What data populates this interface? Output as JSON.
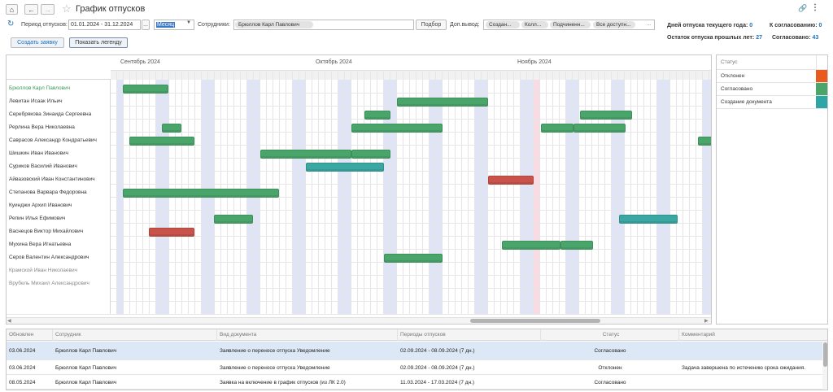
{
  "window": {
    "title": "График отпусков"
  },
  "filters": {
    "period_label": "Период отпусков:",
    "period_value": "01.01.2024 - 31.12.2024",
    "period_btn": "...",
    "scale_value": "Месяц",
    "employees_label": "Сотрудники:",
    "employee_chip": "Брюллов Карл Павлович",
    "select_btn": "Подбор",
    "extra_label": "Доп.вывод:",
    "extra_chips": [
      "Создан...",
      "Колл...",
      "Подчиненн...",
      "Все доступн..."
    ]
  },
  "stats": {
    "days_current_label": "Дней отпуска текущего года:",
    "days_current_value": "0",
    "to_approve_label": "К согласованию:",
    "to_approve_value": "0",
    "remaining_label": "Остаток отпуска прошлых лет:",
    "remaining_value": "27",
    "approved_label": "Согласовано:",
    "approved_value": "43"
  },
  "actions": {
    "create": "Создать заявку",
    "legend": "Показать легенду"
  },
  "timeline": {
    "months": [
      "Сентябрь 2024",
      "Октябрь 2024",
      "Ноябрь 2024"
    ],
    "employees": [
      "Брюллов Карл Павлович",
      "Левитан Исаак Ильич",
      "Серебрякова Зинаида Сергеевна",
      "Рерлина Вера Николаевна",
      "Саврасов Александр Кондратьевич",
      "Шишкин Иван Иванович",
      "Суриков Василий Иванович",
      "Айвазовский Иван Константинович",
      "Степанова Варвара Федоровна",
      "Куинджи Архип Иванович",
      "Репин Илья Ефимович",
      "Васнецов Виктор Михайлович",
      "Мухина Вера Игнатьевна",
      "Серов Валентин Александрович",
      "Крамской Иван Николаевич",
      "Врубель Михаил Александрович"
    ]
  },
  "legend": {
    "header": "Статус",
    "items": [
      {
        "label": "Отклонен",
        "color": "#e85a1e"
      },
      {
        "label": "Согласовано",
        "color": "#4aa56b"
      },
      {
        "label": "Создание документа",
        "color": "#2fa5a5"
      }
    ]
  },
  "table": {
    "columns": [
      "Обновлен",
      "Сотрудник",
      "Вид документа",
      "Периоды отпусков",
      "Статус",
      "Комментарий"
    ],
    "rows": [
      [
        "03.06.2024",
        "Брюллов Карл Павлович",
        "Заявление о переносе отпуска Уведомление",
        "02.09.2024 - 08.09.2024 (7 дн.)",
        "Согласовано",
        ""
      ],
      [
        "03.06.2024",
        "Брюллов Карл Павлович",
        "Заявление о переносе отпуска Уведомление",
        "02.09.2024 - 08.09.2024 (7 дн.)",
        "Отклонен",
        "Задача завершена по истечению срока ожидания."
      ],
      [
        "08.05.2024",
        "Брюллов Карл Павлович",
        "Заявка на включение в график отпусков (из ЛК 2.0)",
        "11.03.2024 - 17.03.2024 (7 дн.)",
        "Согласовано",
        ""
      ]
    ]
  }
}
